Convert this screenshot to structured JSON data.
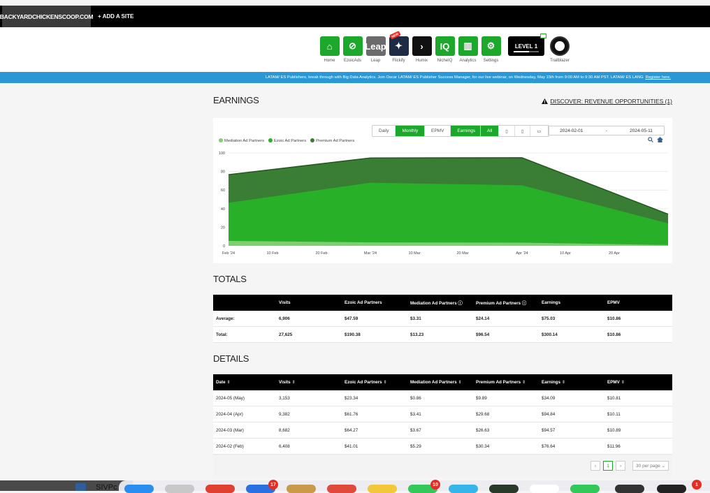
{
  "topbar": {
    "site": "BACKYARDCHICKENSCOOP.COM",
    "add_site": "+ ADD A SITE"
  },
  "nav": {
    "items": [
      {
        "label": "Home",
        "icon": "home-icon",
        "color": "#1ca82b"
      },
      {
        "label": "EzoicAds",
        "icon": "ezoicads-icon",
        "color": "#1ca82b"
      },
      {
        "label": "Leap",
        "icon": "leap-icon",
        "color": "#6b6b6b",
        "text": "Leap"
      },
      {
        "label": "Flickify",
        "icon": "flickify-icon",
        "color": "#1f2a44",
        "badge": "NEW"
      },
      {
        "label": "Humix",
        "icon": "humix-icon",
        "color": "#111111"
      },
      {
        "label": "NicheIQ",
        "icon": "nicheiq-icon",
        "color": "#1ca82b",
        "text": "IQ"
      },
      {
        "label": "Analytics",
        "icon": "analytics-icon",
        "color": "#1ca82b"
      },
      {
        "label": "Settings",
        "icon": "gear-icon",
        "color": "#1ca82b"
      }
    ],
    "level": "LEVEL 1",
    "trailblazer": "Trailblazer"
  },
  "banner": {
    "text": "LATAM/ ES Publishers, break through with Big Data Analytics. Join Oscar LATAM/ ES Publisher Success Manager, for our live webinar, on Wednesday, May 15th from 9:00 AM to 9:30 AM PST. LATAM/ ES LANG",
    "link": "Register here."
  },
  "earnings": {
    "title": "EARNINGS",
    "discover": "DISCOVER: REVENUE OPPORTUNITIES (1)",
    "period": {
      "daily": "Daily",
      "monthly": "Monthly"
    },
    "metric": {
      "epmv": "EPMV",
      "earnings": "Earnings"
    },
    "device": {
      "all": "All"
    },
    "date_from": "2024-02-01",
    "date_sep": "-",
    "date_to": "2024-05-11"
  },
  "chart_data": {
    "type": "area",
    "stacked": true,
    "title": "",
    "xlabel": "",
    "ylabel": "",
    "ylim": [
      0,
      100
    ],
    "yticks": [
      0,
      20,
      40,
      60,
      80,
      100
    ],
    "xticks": [
      "Feb '24",
      "10 Feb",
      "20 Feb",
      "Mar '24",
      "10 Mar",
      "20 Mar",
      "Apr '24",
      "10 Apr",
      "20 Apr"
    ],
    "x": [
      "2024-02",
      "2024-03",
      "2024-04",
      "2024-05"
    ],
    "series": [
      {
        "name": "Mediation Ad Partners",
        "color": "#7fcf72",
        "values": [
          5.29,
          3.67,
          3.41,
          0.86
        ]
      },
      {
        "name": "Ezoic Ad Partners",
        "color": "#28b128",
        "values": [
          41.01,
          64.27,
          61.76,
          23.34
        ]
      },
      {
        "name": "Premium Ad Partners",
        "color": "#3a7d35",
        "values": [
          30.34,
          26.63,
          29.68,
          9.89
        ]
      }
    ],
    "grid": true,
    "legend": "top-left"
  },
  "totals": {
    "title": "TOTALS",
    "headers": [
      "",
      "Visits",
      "Ezoic Ad Partners",
      "Mediation Ad Partners",
      "Premium Ad Partners",
      "Earnings",
      "EPMV"
    ],
    "rows": [
      [
        "Average:",
        "6,906",
        "$47.59",
        "$3.31",
        "$24.14",
        "$75.03",
        "$10.86"
      ],
      [
        "Total:",
        "27,625",
        "$190.38",
        "$13.23",
        "$96.54",
        "$300.14",
        "$10.86"
      ]
    ]
  },
  "details": {
    "title": "DETAILS",
    "headers": [
      "Date",
      "Visits",
      "Ezoic Ad Partners",
      "Mediation Ad Partners",
      "Premium Ad Partners",
      "Earnings",
      "EPMV"
    ],
    "rows": [
      [
        "2024-05 (May)",
        "3,153",
        "$23.34",
        "$0.86",
        "$9.89",
        "$34.09",
        "$10.81"
      ],
      [
        "2024-04 (Apr)",
        "9,382",
        "$61.76",
        "$3.41",
        "$29.68",
        "$94.84",
        "$10.11"
      ],
      [
        "2024-03 (Mar)",
        "8,682",
        "$64.27",
        "$3.67",
        "$26.63",
        "$94.57",
        "$10.89"
      ],
      [
        "2024-02 (Feb)",
        "6,408",
        "$41.01",
        "$5.29",
        "$30.34",
        "$76.64",
        "$11.96"
      ]
    ],
    "page": "1",
    "per_page": "30 per page"
  },
  "dock": {
    "name": "SIVPc",
    "badges": [
      "17",
      "10",
      "1"
    ]
  }
}
